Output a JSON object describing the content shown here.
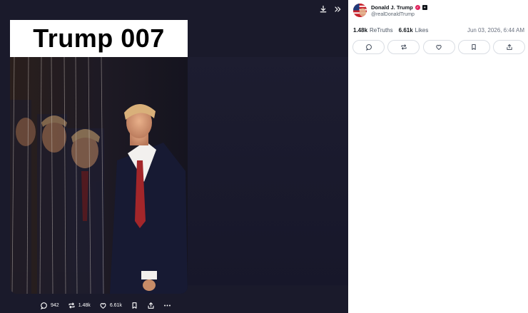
{
  "viewer": {
    "banner_text": "Trump 007",
    "actions": {
      "replies": "942",
      "retruths": "1.48k",
      "likes": "6.61k"
    },
    "top_icons": [
      "download-icon",
      "collapse-icon"
    ]
  },
  "post": {
    "author_name": "Donald J. Trump",
    "author_handle": "@realDonaldTrump",
    "retruths_count": "1.48k",
    "retruths_label": "ReTruths",
    "likes_count": "6.61k",
    "likes_label": "Likes",
    "timestamp": "Jun 03, 2026, 6:44 AM",
    "buttons": [
      "reply-icon",
      "retruth-icon",
      "like-icon",
      "bookmark-icon",
      "share-icon"
    ]
  },
  "colors": {
    "viewer_bg": "#1a1a2b",
    "verified": "#e0245e",
    "pill_border": "#d9dde3"
  }
}
